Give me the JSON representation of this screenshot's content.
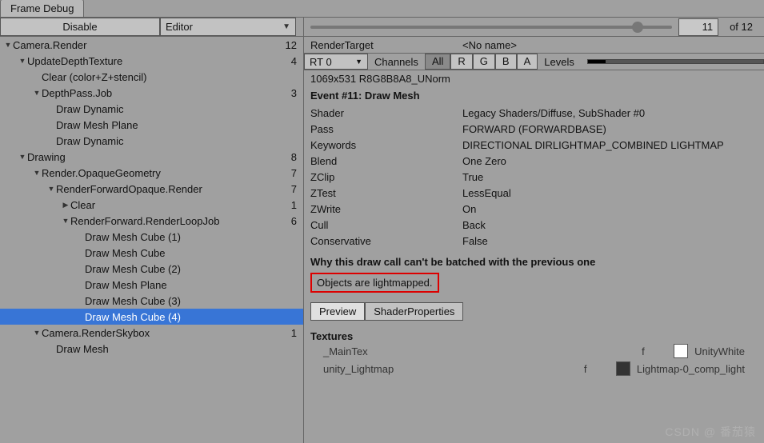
{
  "tab": {
    "title": "Frame Debug"
  },
  "toolbar": {
    "disable_label": "Disable",
    "target_label": "Editor",
    "event_number": "11",
    "of_label": "of 12"
  },
  "tree": [
    {
      "indent": 0,
      "fold": "down",
      "label": "Camera.Render",
      "count": "12"
    },
    {
      "indent": 1,
      "fold": "down",
      "label": "UpdateDepthTexture",
      "count": "4"
    },
    {
      "indent": 2,
      "fold": "",
      "label": "Clear (color+Z+stencil)",
      "count": ""
    },
    {
      "indent": 2,
      "fold": "down",
      "label": "DepthPass.Job",
      "count": "3"
    },
    {
      "indent": 3,
      "fold": "",
      "label": "Draw Dynamic",
      "count": ""
    },
    {
      "indent": 3,
      "fold": "",
      "label": "Draw Mesh Plane",
      "count": ""
    },
    {
      "indent": 3,
      "fold": "",
      "label": "Draw Dynamic",
      "count": ""
    },
    {
      "indent": 1,
      "fold": "down",
      "label": "Drawing",
      "count": "8"
    },
    {
      "indent": 2,
      "fold": "down",
      "label": "Render.OpaqueGeometry",
      "count": "7"
    },
    {
      "indent": 3,
      "fold": "down",
      "label": "RenderForwardOpaque.Render",
      "count": "7"
    },
    {
      "indent": 4,
      "fold": "right",
      "label": "Clear",
      "count": "1"
    },
    {
      "indent": 4,
      "fold": "down",
      "label": "RenderForward.RenderLoopJob",
      "count": "6"
    },
    {
      "indent": 5,
      "fold": "",
      "label": "Draw Mesh Cube (1)",
      "count": ""
    },
    {
      "indent": 5,
      "fold": "",
      "label": "Draw Mesh Cube",
      "count": ""
    },
    {
      "indent": 5,
      "fold": "",
      "label": "Draw Mesh Cube (2)",
      "count": ""
    },
    {
      "indent": 5,
      "fold": "",
      "label": "Draw Mesh Plane",
      "count": ""
    },
    {
      "indent": 5,
      "fold": "",
      "label": "Draw Mesh Cube (3)",
      "count": ""
    },
    {
      "indent": 5,
      "fold": "",
      "label": "Draw Mesh Cube (4)",
      "count": "",
      "selected": true
    },
    {
      "indent": 2,
      "fold": "down",
      "label": "Camera.RenderSkybox",
      "count": "1"
    },
    {
      "indent": 3,
      "fold": "",
      "label": "Draw Mesh",
      "count": ""
    }
  ],
  "details": {
    "render_target_label": "RenderTarget",
    "render_target_value": "<No name>",
    "rt_dd": "RT 0",
    "channels_label": "Channels",
    "chan_all": "All",
    "chan_r": "R",
    "chan_g": "G",
    "chan_b": "B",
    "chan_a": "A",
    "levels_label": "Levels",
    "rt_info": "1069x531 R8G8B8A8_UNorm",
    "event_title": "Event #11: Draw Mesh",
    "rows": [
      {
        "label": "Shader",
        "value": "Legacy Shaders/Diffuse, SubShader #0"
      },
      {
        "label": "Pass",
        "value": "FORWARD (FORWARDBASE)"
      },
      {
        "label": "Keywords",
        "value": "DIRECTIONAL DIRLIGHTMAP_COMBINED LIGHTMAP"
      },
      {
        "label": "Blend",
        "value": "One Zero"
      },
      {
        "label": "ZClip",
        "value": "True"
      },
      {
        "label": "ZTest",
        "value": "LessEqual"
      },
      {
        "label": "ZWrite",
        "value": "On"
      },
      {
        "label": "Cull",
        "value": "Back"
      },
      {
        "label": "Conservative",
        "value": "False"
      }
    ],
    "batch_title": "Why this draw call can't be batched with the previous one",
    "batch_reason": "Objects are lightmapped.",
    "preview_btn": "Preview",
    "shaderprops_btn": "ShaderProperties",
    "textures_title": "Textures",
    "tex1_name": "_MainTex",
    "tex1_f": "f",
    "tex1_val": "UnityWhite",
    "tex2_name": "unity_Lightmap",
    "tex2_f": "f",
    "tex2_val": "Lightmap-0_comp_light"
  },
  "watermark": "CSDN @ 番茄猿"
}
